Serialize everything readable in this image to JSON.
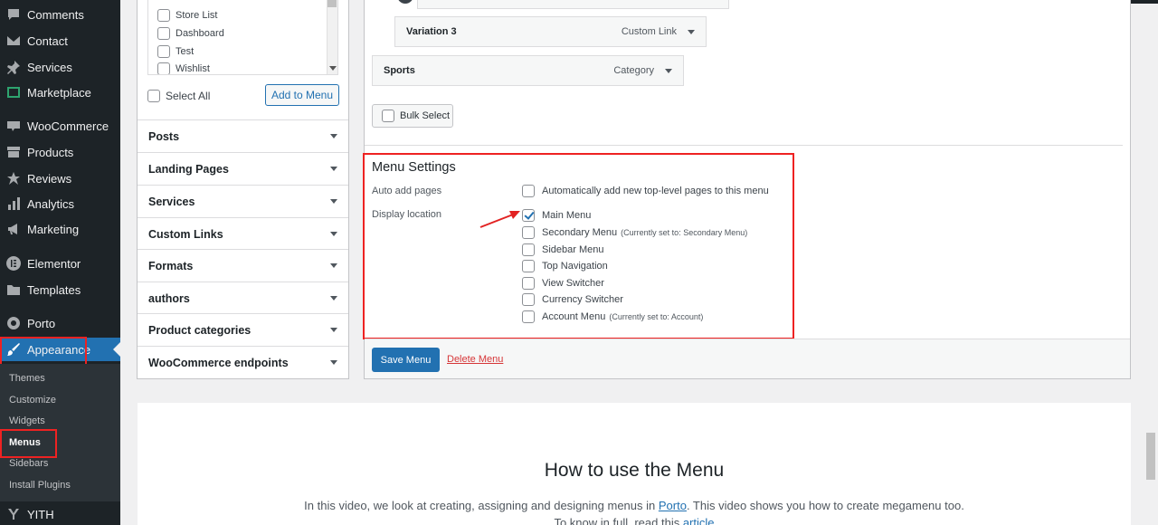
{
  "sidebar": {
    "items": [
      {
        "label": "Comments",
        "icon": "comment-icon"
      },
      {
        "label": "Contact",
        "icon": "envelope-icon"
      },
      {
        "label": "Services",
        "icon": "pin-icon"
      },
      {
        "label": "Marketplace",
        "icon": "marketplace-icon"
      },
      {
        "label": "WooCommerce",
        "icon": "woo-icon"
      },
      {
        "label": "Products",
        "icon": "archive-icon"
      },
      {
        "label": "Reviews",
        "icon": "star-icon"
      },
      {
        "label": "Analytics",
        "icon": "bar-chart-icon"
      },
      {
        "label": "Marketing",
        "icon": "megaphone-icon"
      },
      {
        "label": "Elementor",
        "icon": "elementor-icon"
      },
      {
        "label": "Templates",
        "icon": "folder-icon"
      },
      {
        "label": "Porto",
        "icon": "porto-icon"
      },
      {
        "label": "Appearance",
        "icon": "brush-icon"
      },
      {
        "label": "YITH",
        "icon": "yith-icon"
      }
    ],
    "submenu": [
      "Themes",
      "Customize",
      "Widgets",
      "Menus",
      "Sidebars",
      "Install Plugins"
    ]
  },
  "left_panel": {
    "pages": [
      "Store List",
      "Dashboard",
      "Test",
      "Wishlist"
    ],
    "select_all": "Select All",
    "add_to_menu": "Add to Menu",
    "sections": [
      "Posts",
      "Landing Pages",
      "Services",
      "Custom Links",
      "Formats",
      "authors",
      "Product categories",
      "WooCommerce endpoints"
    ]
  },
  "menu_structure": {
    "items": [
      {
        "title": "Variation 3",
        "type": "Custom Link"
      },
      {
        "title": "Sports",
        "type": "Category"
      }
    ],
    "bulk_select": "Bulk Select"
  },
  "menu_settings": {
    "title": "Menu Settings",
    "auto_add_label": "Auto add pages",
    "auto_add_option": "Automatically add new top-level pages to this menu",
    "display_location_label": "Display location",
    "locations": [
      {
        "label": "Main Menu",
        "note": "",
        "checked": true
      },
      {
        "label": "Secondary Menu",
        "note": "(Currently set to: Secondary Menu)",
        "checked": false
      },
      {
        "label": "Sidebar Menu",
        "note": "",
        "checked": false
      },
      {
        "label": "Top Navigation",
        "note": "",
        "checked": false
      },
      {
        "label": "View Switcher",
        "note": "",
        "checked": false
      },
      {
        "label": "Currency Switcher",
        "note": "",
        "checked": false
      },
      {
        "label": "Account Menu",
        "note": "(Currently set to: Account)",
        "checked": false
      }
    ],
    "save": "Save Menu",
    "delete": "Delete Menu"
  },
  "video": {
    "title": "How to use the Menu",
    "desc_before": "In this video, we look at creating, assigning and designing menus in ",
    "desc_link": "Porto",
    "desc_after": ". This video shows you how to create megamenu too.",
    "desc2_before": "To know in full, read this ",
    "desc2_link": "article"
  },
  "colors": {
    "accent": "#2271b1",
    "highlight": "#e22222",
    "sidebar_bg": "#1d2327"
  }
}
